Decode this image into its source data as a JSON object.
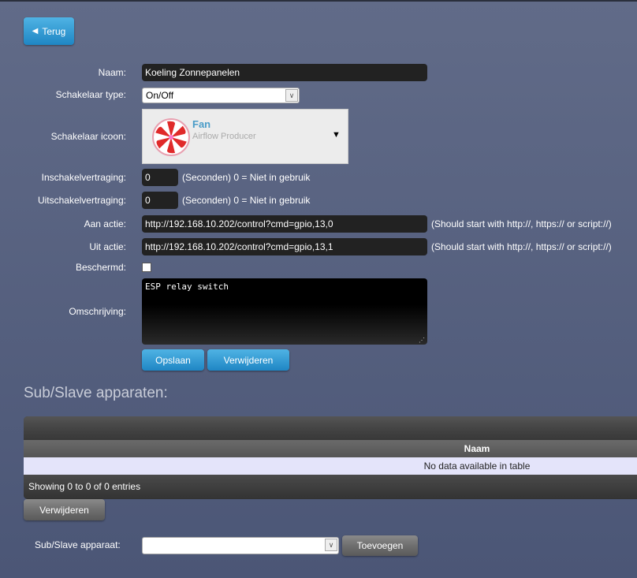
{
  "back_button": "Terug",
  "form": {
    "naam_label": "Naam:",
    "naam_value": "Koeling Zonnepanelen",
    "type_label": "Schakelaar type:",
    "type_value": "On/Off",
    "icon_label": "Schakelaar icoon:",
    "icon_name": "Fan",
    "icon_desc": "Airflow Producer",
    "on_delay_label": "Inschakelvertraging:",
    "on_delay_value": "0",
    "on_delay_hint": "(Seconden) 0 = Niet in gebruik",
    "off_delay_label": "Uitschakelvertraging:",
    "off_delay_value": "0",
    "off_delay_hint": "(Seconden) 0 = Niet in gebruik",
    "on_action_label": "Aan actie:",
    "on_action_value": "http://192.168.10.202/control?cmd=gpio,13,0",
    "on_action_hint": "(Should start with http://, https:// or script://)",
    "off_action_label": "Uit actie:",
    "off_action_value": "http://192.168.10.202/control?cmd=gpio,13,1",
    "off_action_hint": "(Should start with http://, https:// or script://)",
    "protected_label": "Beschermd:",
    "protected_checked": false,
    "desc_label": "Omschrijving:",
    "desc_value": "ESP relay switch",
    "save": "Opslaan",
    "delete": "Verwijderen"
  },
  "sub": {
    "title": "Sub/Slave apparaten:",
    "table": {
      "columns": [
        "Naam"
      ],
      "empty": "No data available in table",
      "info": "Showing 0 to 0 of 0 entries"
    },
    "delete": "Verwijderen",
    "device_label": "Sub/Slave apparaat:",
    "device_value": "",
    "add": "Toevoegen"
  }
}
